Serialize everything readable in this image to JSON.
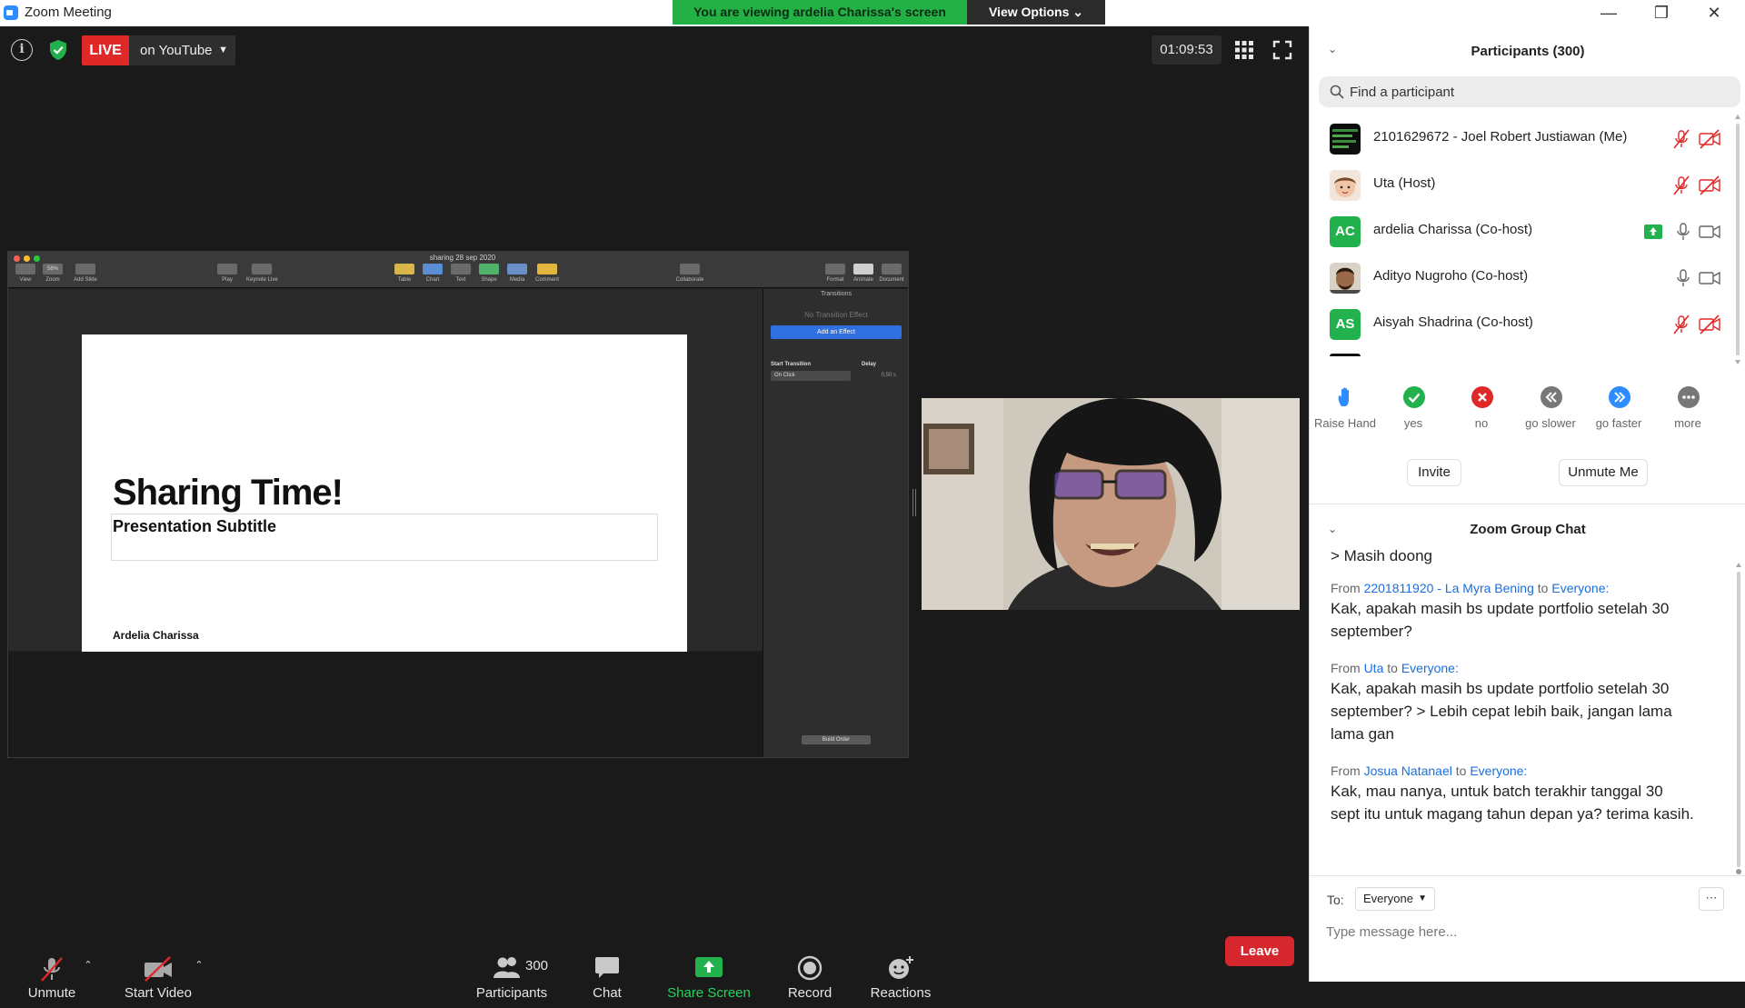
{
  "window": {
    "title": "Zoom Meeting",
    "controls": [
      "minimize",
      "restore",
      "close"
    ]
  },
  "banner": {
    "viewing_text": "You are viewing ardelia Charissa's screen",
    "view_options_label": "View Options"
  },
  "topbar": {
    "live_label": "LIVE",
    "live_destination": "on YouTube",
    "timer": "01:09:53"
  },
  "shared_screen": {
    "document_title": "sharing 28 sep 2020",
    "toolbar_items": [
      {
        "label": "View",
        "icon": "view-icon"
      },
      {
        "label": "Zoom",
        "icon": "zoom-icon",
        "value": "58%"
      },
      {
        "label": "Add Slide",
        "icon": "plus-icon"
      },
      {
        "label": "Play",
        "icon": "play-icon"
      },
      {
        "label": "Keynote Live",
        "icon": "keynote-live-icon"
      },
      {
        "label": "Table",
        "icon": "table-icon"
      },
      {
        "label": "Chart",
        "icon": "chart-icon"
      },
      {
        "label": "Text",
        "icon": "text-icon"
      },
      {
        "label": "Shape",
        "icon": "shape-icon"
      },
      {
        "label": "Media",
        "icon": "media-icon"
      },
      {
        "label": "Comment",
        "icon": "comment-icon"
      },
      {
        "label": "Collaborate",
        "icon": "collaborate-icon"
      },
      {
        "label": "Format",
        "icon": "format-icon"
      },
      {
        "label": "Animate",
        "icon": "animate-icon"
      },
      {
        "label": "Document",
        "icon": "document-icon"
      }
    ],
    "slide": {
      "title": "Sharing Time!",
      "subtitle": "Presentation Subtitle",
      "author": "Ardelia Charissa"
    },
    "inspector": {
      "title": "Transitions",
      "no_effect": "No Transition Effect",
      "add_effect": "Add an Effect",
      "start_transition_label": "Start Transition",
      "delay_label": "Delay",
      "start_transition_value": "On Click",
      "delay_value": "0,50 s",
      "build_order": "Build Order"
    }
  },
  "toolbar": {
    "unmute": "Unmute",
    "start_video": "Start Video",
    "participants": "Participants",
    "participants_count": "300",
    "chat": "Chat",
    "share_screen": "Share Screen",
    "record": "Record",
    "reactions": "Reactions",
    "leave": "Leave"
  },
  "participants_panel": {
    "title": "Participants (300)",
    "search_placeholder": "Find a participant",
    "participants": [
      {
        "name": "2101629672 - Joel Robert Justiawan (Me)",
        "avatar": "image",
        "muted": true,
        "video_off": true,
        "sharing": false
      },
      {
        "name": "Uta (Host)",
        "avatar": "image",
        "muted": true,
        "video_off": true,
        "sharing": false
      },
      {
        "name": "ardelia Charissa (Co-host)",
        "avatar": "initials",
        "initials": "AC",
        "muted": false,
        "video_off": false,
        "sharing": true
      },
      {
        "name": "Adityo Nugroho (Co-host)",
        "avatar": "image",
        "muted": false,
        "video_off": false,
        "sharing": false
      },
      {
        "name": "Aisyah Shadrina (Co-host)",
        "avatar": "initials",
        "initials": "AS",
        "muted": true,
        "video_off": true,
        "sharing": false
      }
    ],
    "reactions": [
      {
        "label": "Raise Hand",
        "icon": "raise-hand-icon",
        "color": "#2d8cff"
      },
      {
        "label": "yes",
        "icon": "check-icon",
        "color": "#23b14d"
      },
      {
        "label": "no",
        "icon": "x-icon",
        "color": "#e02828"
      },
      {
        "label": "go slower",
        "icon": "rewind-icon",
        "color": "#777777"
      },
      {
        "label": "go faster",
        "icon": "fast-forward-icon",
        "color": "#2d8cff"
      },
      {
        "label": "more",
        "icon": "more-icon",
        "color": "#777777"
      }
    ],
    "invite": "Invite",
    "unmute_me": "Unmute Me"
  },
  "chat_panel": {
    "title": "Zoom Group Chat",
    "previous_fragment": "> Masih doong",
    "messages": [
      {
        "from_prefix": "From",
        "sender": "2201811920 - La Myra Bening",
        "to_word": "to",
        "recipient": "Everyone:",
        "text": "Kak, apakah masih bs update portfolio setelah 30 september?"
      },
      {
        "from_prefix": "From",
        "sender": "Uta",
        "to_word": "to",
        "recipient": "Everyone:",
        "text": "Kak, apakah masih bs update portfolio setelah 30 september? > Lebih cepat lebih baik, jangan lama lama gan"
      },
      {
        "from_prefix": "From",
        "sender": "Josua Natanael",
        "to_word": "to",
        "recipient": "Everyone:",
        "text": "Kak, mau nanya, untuk batch terakhir tanggal 30 sept itu untuk magang tahun depan ya? terima kasih."
      }
    ],
    "to_label": "To:",
    "to_value": "Everyone",
    "input_placeholder": "Type message here..."
  },
  "colors": {
    "accent_blue": "#2d8cff",
    "live_red": "#e02828",
    "share_green": "#23b14d",
    "leave_red": "#d6272e"
  }
}
